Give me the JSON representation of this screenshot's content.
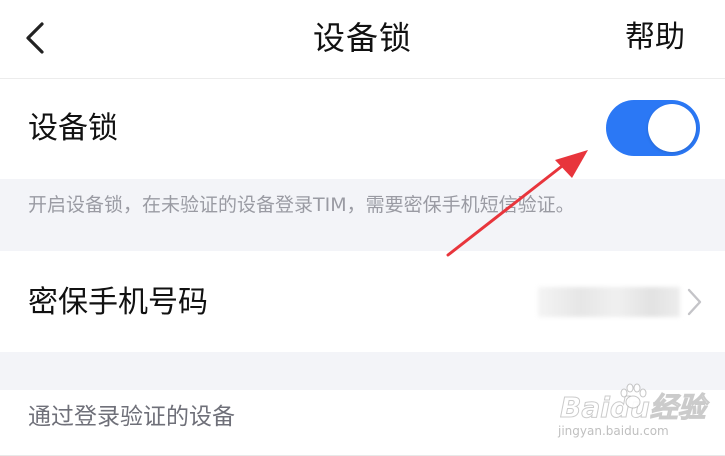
{
  "header": {
    "back_icon": "chevron-left-icon",
    "title": "设备锁",
    "help_label": "帮助"
  },
  "device_lock": {
    "label": "设备锁",
    "enabled": true,
    "toggle_color": "#2b78f5"
  },
  "info": {
    "text": "开启设备锁，在未验证的设备登录TIM，需要密保手机短信验证。"
  },
  "phone": {
    "label": "密保手机号码",
    "value": "",
    "chevron_icon": "chevron-right-icon"
  },
  "devices": {
    "title": "通过登录验证的设备"
  },
  "annotation": {
    "color": "#e8353c",
    "icon": "red-arrow-annotation"
  },
  "watermark": {
    "brand": "Baidu经验",
    "url": "jingyan.baidu.com"
  }
}
